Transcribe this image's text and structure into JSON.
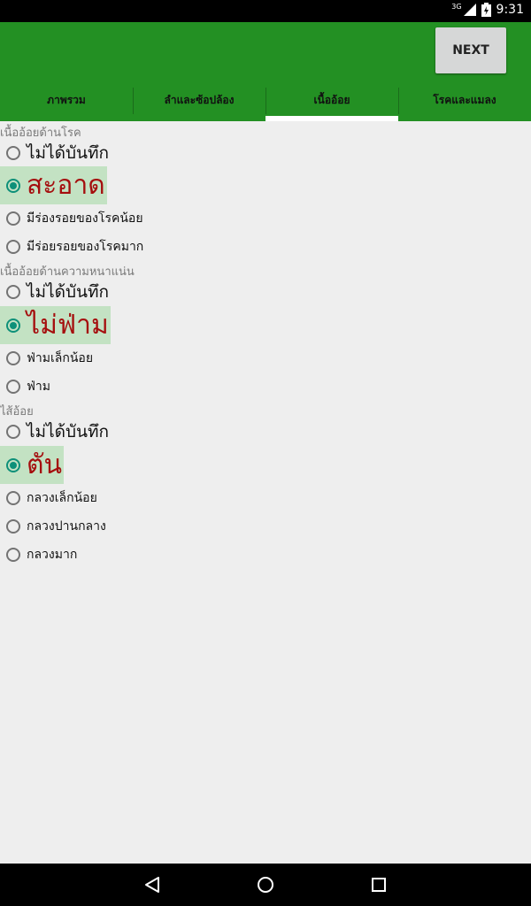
{
  "status_bar": {
    "network": "3G",
    "time": "9:31"
  },
  "toolbar": {
    "next_label": "NEXT"
  },
  "tabs": [
    {
      "label": "ภาพรวม"
    },
    {
      "label": "ลำและซ้อปล้อง"
    },
    {
      "label": "เนื้ออ้อย"
    },
    {
      "label": "โรคและแมลง"
    }
  ],
  "active_tab": "เนื้ออ้อย",
  "sections": [
    {
      "label": "เนื้ออ้อยด้านโรค",
      "options": [
        {
          "label": "ไม่ได้บันทึก",
          "selected": false
        },
        {
          "label": "สะอาด",
          "selected": true
        },
        {
          "label": "มีร่องรอยของโรคน้อย",
          "selected": false
        },
        {
          "label": "มีร่อยรอยของโรคมาก",
          "selected": false
        }
      ]
    },
    {
      "label": "เนื้ออ้อยด้านความหนาแน่น",
      "options": [
        {
          "label": "ไม่ได้บันทึก",
          "selected": false
        },
        {
          "label": "ไม่ฟ่าม",
          "selected": true
        },
        {
          "label": "ฟ่ามเล็กน้อย",
          "selected": false
        },
        {
          "label": "ฟ่าม",
          "selected": false
        }
      ]
    },
    {
      "label": "ไส้อ้อย",
      "options": [
        {
          "label": "ไม่ได้บันทึก",
          "selected": false
        },
        {
          "label": "ตัน",
          "selected": true
        },
        {
          "label": "กลวงเล็กน้อย",
          "selected": false
        },
        {
          "label": "กลวงปานกลาง",
          "selected": false
        },
        {
          "label": "กลวงมาก",
          "selected": false
        }
      ]
    }
  ],
  "colors": {
    "app_bar": "#239023",
    "radio_checked": "#0e9079",
    "selected_text": "#a50e0e",
    "selected_highlight": "#c3e2c3"
  }
}
